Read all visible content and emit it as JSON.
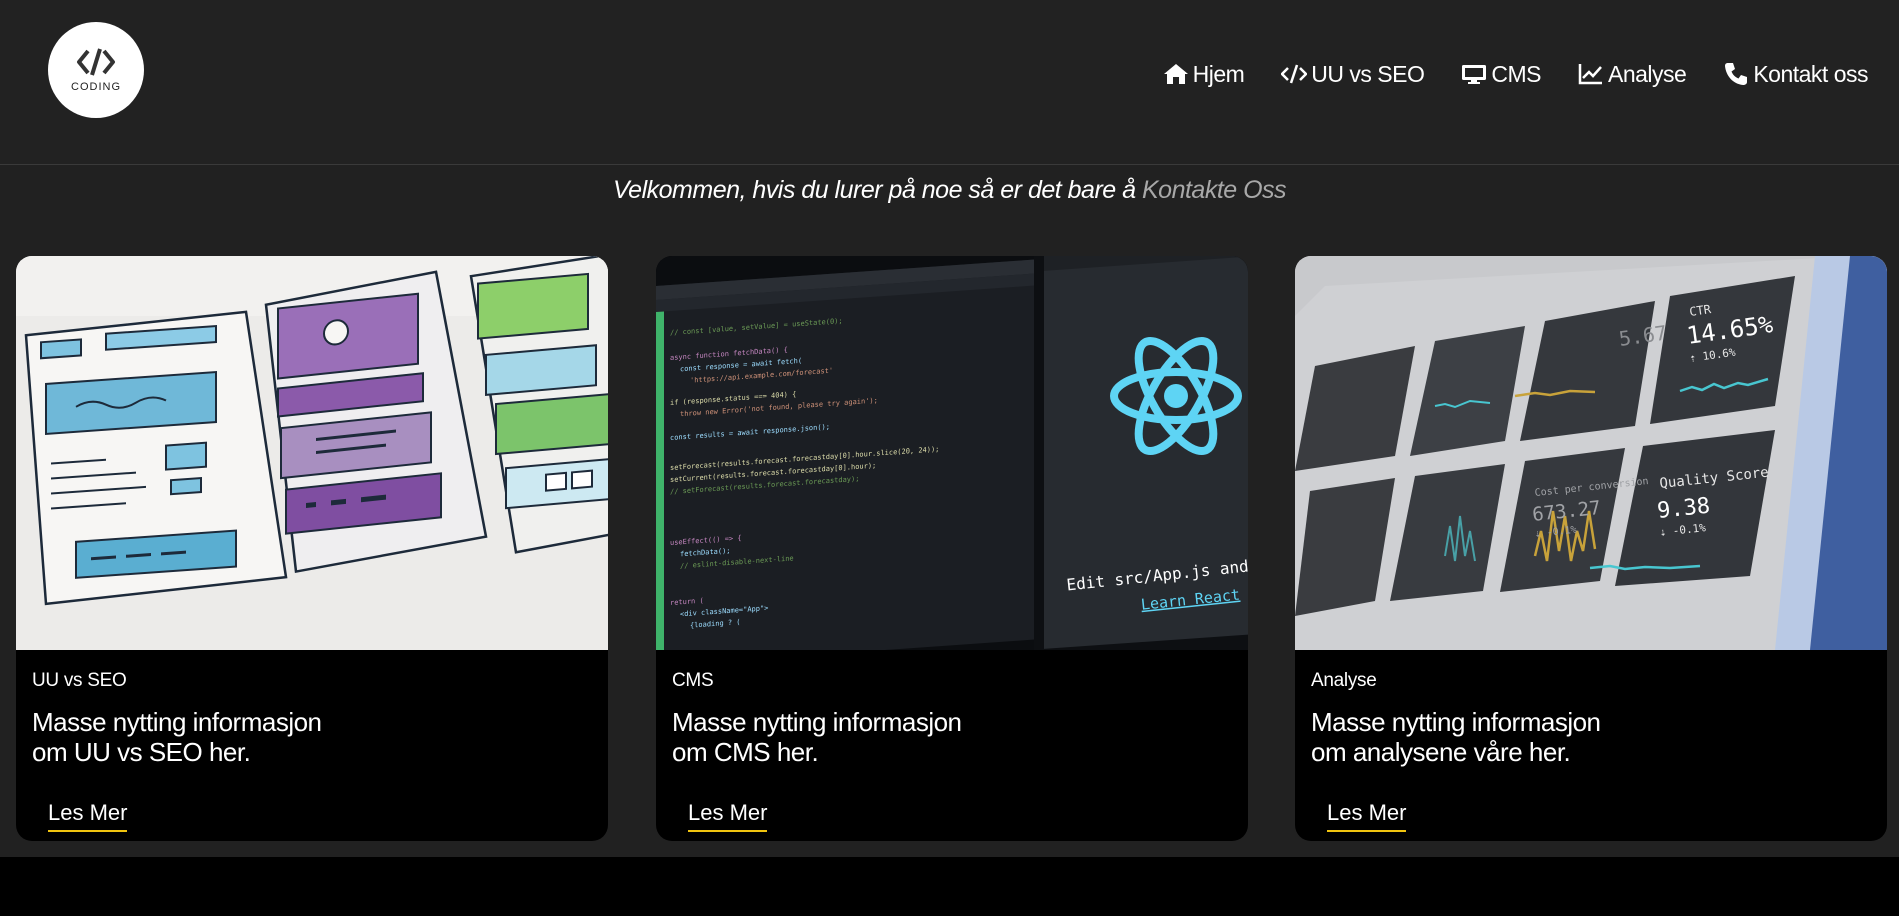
{
  "logo": {
    "text": "CODING",
    "icon": "code-brackets-icon"
  },
  "nav": {
    "items": [
      {
        "label": "Hjem",
        "icon": "home-icon"
      },
      {
        "label": "UU vs SEO",
        "icon": "code-icon"
      },
      {
        "label": "CMS",
        "icon": "desktop-icon"
      },
      {
        "label": "Analyse",
        "icon": "line-chart-icon"
      },
      {
        "label": "Kontakt oss",
        "icon": "phone-icon"
      }
    ]
  },
  "welcome": {
    "text": "Velkommen, hvis du lurer på noe så er det bare å ",
    "link": "Kontakte Oss"
  },
  "cards": [
    {
      "tag": "UU vs SEO",
      "line1": "Masse nytting informasjon",
      "line2": "om UU vs SEO her.",
      "button": "Les Mer",
      "image": "wireframe-sketch-image"
    },
    {
      "tag": "CMS",
      "line1": "Masse nytting informasjon",
      "line2": "om CMS her.",
      "button": "Les Mer",
      "image": "code-editor-react-image",
      "image_text": {
        "edit": "Edit src/App.js and save to rel",
        "learn": "Learn React"
      }
    },
    {
      "tag": "Analyse",
      "line1": "Masse nytting informasjon",
      "line2": "om analysene våre her.",
      "button": "Les Mer",
      "image": "analytics-dashboard-image",
      "image_text": {
        "ctr_label": "CTR",
        "ctr_value": "14.65%",
        "ctr_delta": "⇡ 10.6%",
        "q_label": "Quality Score",
        "q_value": "9.38",
        "q_delta": "⇣ -0.1%",
        "cpc_label": "Cost per conversion",
        "cpc_value": "673.27",
        "cpc_delta": "⇣ -0.1%",
        "v1_value": "5.67"
      }
    }
  ],
  "colors": {
    "background": "#212121",
    "accent": "#f1c40f",
    "link_muted": "#a8a8a8",
    "react": "#5ed4f4"
  }
}
